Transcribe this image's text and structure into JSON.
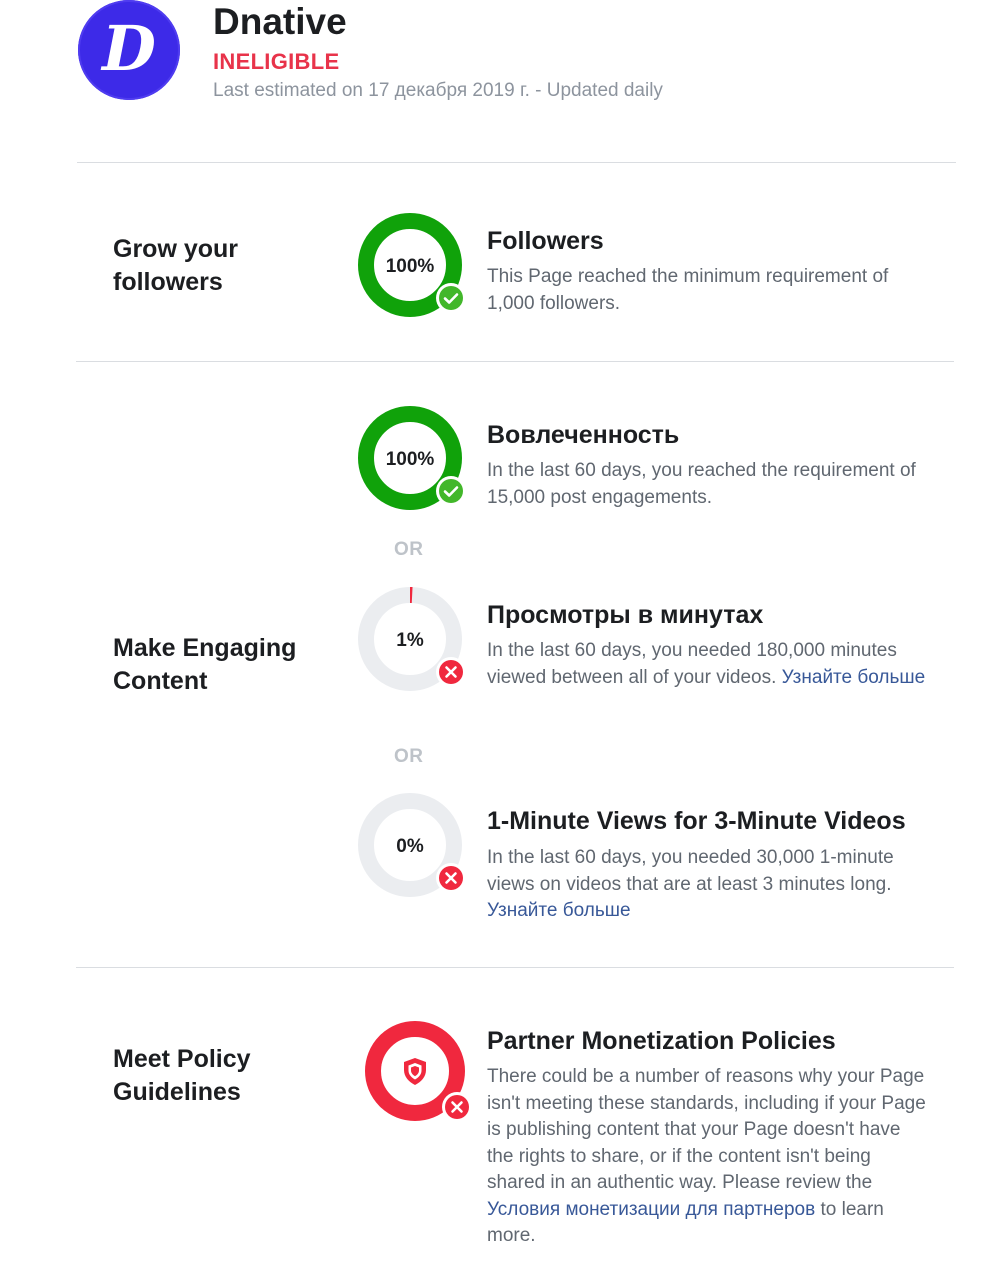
{
  "header": {
    "page_name": "Dnative",
    "status": "INELIGIBLE",
    "estimated": "Last estimated on 17 декабря 2019 г. - Updated daily",
    "avatar_letter": "D"
  },
  "sections": {
    "grow": {
      "title": "Grow your followers",
      "followers": {
        "percent_label": "100%",
        "progress": 1.0,
        "status": "met",
        "title": "Followers",
        "description": "This Page reached the minimum requirement of 1,000 followers."
      }
    },
    "engage": {
      "title": "Make Engaging Content",
      "engagement": {
        "percent_label": "100%",
        "progress": 1.0,
        "status": "met",
        "title": "Вовлеченность",
        "description": "In the last 60 days, you reached the requirement of 15,000 post engagements."
      },
      "or_1": "OR",
      "minutes": {
        "percent_label": "1%",
        "progress": 0.01,
        "status": "not-met",
        "title": "Просмотры в минутах",
        "description": "In the last 60 days, you needed 180,000 minutes viewed between all of your videos.",
        "link": "Узнайте больше"
      },
      "or_2": "OR",
      "one_minute": {
        "percent_label": "0%",
        "progress": 0.0,
        "status": "not-met",
        "title": "1-Minute Views for 3-Minute Videos",
        "description": "In the last 60 days, you needed 30,000 1-minute views on videos that are at least 3 minutes long.",
        "link": "Узнайте больше"
      }
    },
    "policy": {
      "title": "Meet Policy Guidelines",
      "monetization": {
        "status": "not-met",
        "title": "Partner Monetization Policies",
        "description_before": "There could be a number of reasons why your Page isn't meeting these standards, including if your Page is publishing content that your Page doesn't have the rights to share, or if the content isn't being shared in an authentic way. Please review the",
        "link": "Условия монетизации для партнеров",
        "description_after": "to learn more.",
        "icon": "shield-icon"
      }
    }
  },
  "colors": {
    "success": "#10a20a",
    "success_badge": "#42b72a",
    "error": "#f0283e",
    "track": "#ebedf0",
    "link": "#385898",
    "avatar": "#3d2ae8"
  }
}
